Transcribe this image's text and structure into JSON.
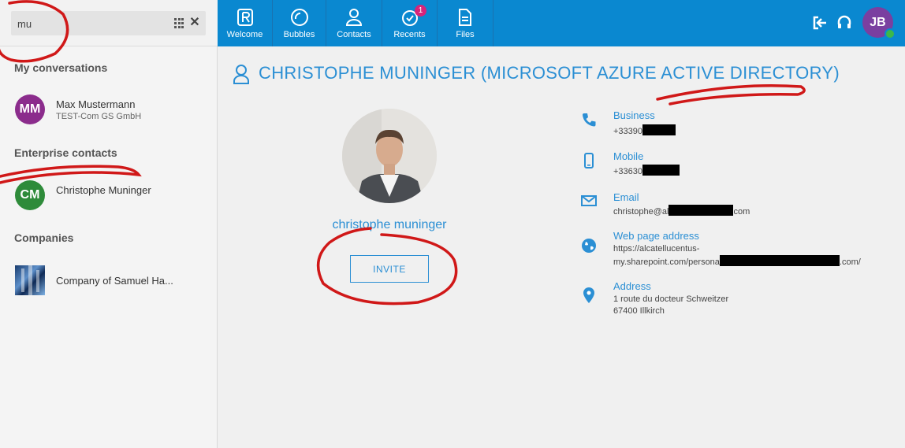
{
  "search": {
    "value": "mu"
  },
  "sidebar": {
    "my_conversations_title": "My conversations",
    "conversations": [
      {
        "initials": "MM",
        "name": "Max Mustermann",
        "company": "TEST-Com GS GmbH",
        "avatar_color": "#8b2c8c"
      }
    ],
    "enterprise_title": "Enterprise contacts",
    "enterprise": [
      {
        "initials": "CM",
        "name": "Christophe Muninger",
        "avatar_color": "#2e8b3a"
      }
    ],
    "companies_title": "Companies",
    "companies": [
      {
        "name": "Company of Samuel Ha..."
      }
    ]
  },
  "nav": {
    "items": [
      {
        "label": "Welcome",
        "icon": "rainbow-logo-icon"
      },
      {
        "label": "Bubbles",
        "icon": "bubbles-icon"
      },
      {
        "label": "Contacts",
        "icon": "contacts-icon"
      },
      {
        "label": "Recents",
        "icon": "recents-icon",
        "badge": "1"
      },
      {
        "label": "Files",
        "icon": "files-icon"
      }
    ],
    "user_initials": "JB",
    "accent": "#0a88d0"
  },
  "profile": {
    "title": "CHRISTOPHE MUNINGER (MICROSOFT AZURE ACTIVE DIRECTORY)",
    "display_name": "christophe muninger",
    "invite_label": "INVITE",
    "business_label": "Business",
    "business_value": "+33390",
    "mobile_label": "Mobile",
    "mobile_value": "+33630",
    "email_label": "Email",
    "email_prefix": "christophe@al",
    "email_suffix": "com",
    "web_label": "Web page address",
    "web_line1": "https://alcatellucentus-",
    "web_line2_prefix": "my.sharepoint.com/persona",
    "web_line2_suffix": ".com/",
    "address_label": "Address",
    "address_line1": "1 route du docteur Schweitzer",
    "address_line2": "67400 Illkirch"
  }
}
